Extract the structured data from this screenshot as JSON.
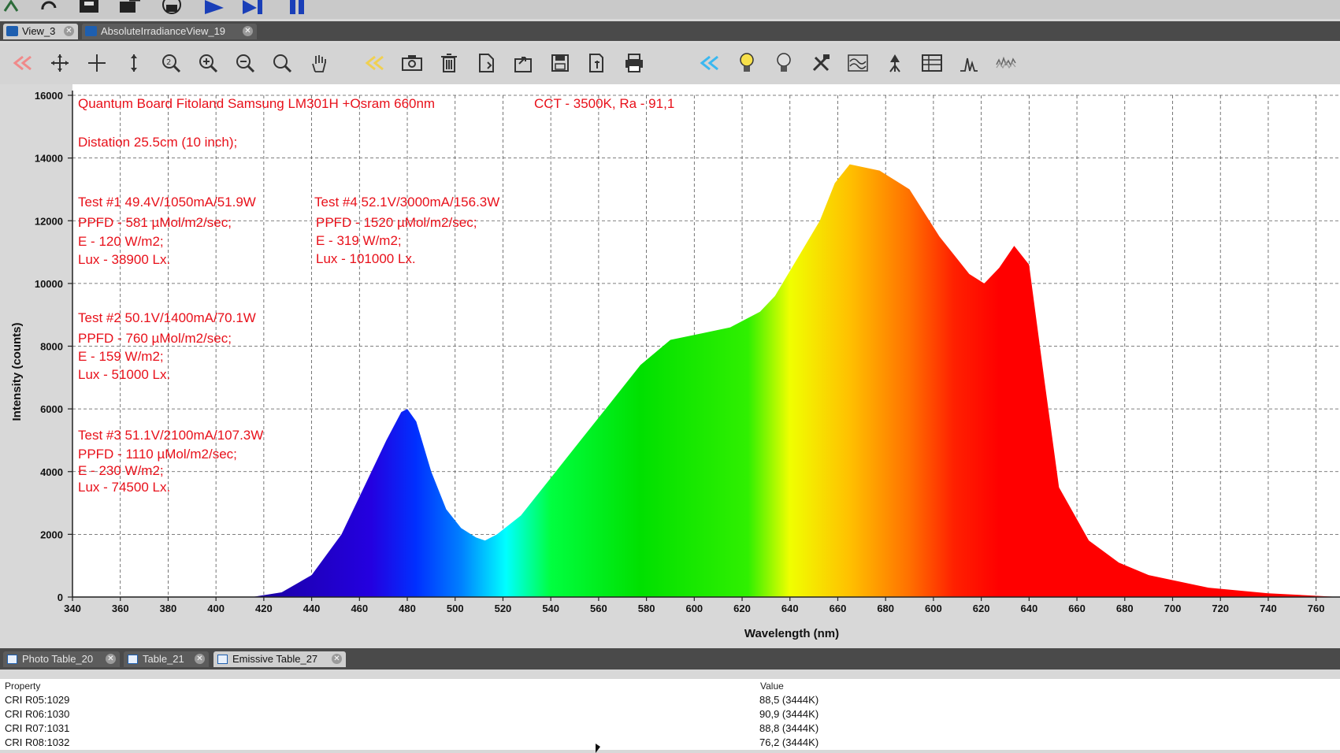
{
  "window_tabs": [
    {
      "label": "View_3",
      "active": true
    },
    {
      "label": "AbsoluteIrradianceView_19",
      "active": false
    }
  ],
  "toolbar_icons": [
    "back-red-icon",
    "move-cross-icon",
    "crosshair-icon",
    "vertical-arrow-icon",
    "zoom-reset-icon",
    "zoom-in-icon",
    "zoom-out-icon",
    "zoom-fit-icon",
    "pan-hand-icon",
    "back-yellow-icon",
    "camera-icon",
    "trash-icon",
    "copy-doc-icon",
    "export-icon",
    "save-icon",
    "doc-settings-icon",
    "print-icon",
    "back-cyan-icon",
    "bulb-on-icon",
    "bulb-off-icon",
    "tools-icon",
    "wave-icon",
    "peak-marker-icon",
    "table-icon",
    "spectrum-peak-icon",
    "spectrum-noise-icon"
  ],
  "chart_data": {
    "type": "area",
    "xlabel": "Wavelength (nm)",
    "ylabel": "Intensity (counts)",
    "xlim": [
      340,
      764
    ],
    "ylim": [
      0,
      16000
    ],
    "x_ticks": [
      "340",
      "360",
      "380",
      "400",
      "420",
      "440",
      "460",
      "480",
      "500",
      "520",
      "540",
      "560",
      "580",
      "600",
      "620",
      "640",
      "660",
      "680",
      "600",
      "620",
      "640",
      "660",
      "680",
      "700",
      "720",
      "740",
      "760"
    ],
    "y_ticks": [
      "0",
      "2000",
      "4000",
      "6000",
      "8000",
      "10000",
      "12000",
      "14000",
      "16000"
    ],
    "grid": true,
    "x": [
      340,
      400,
      410,
      420,
      430,
      440,
      445,
      450,
      452,
      455,
      460,
      465,
      470,
      475,
      478,
      482,
      490,
      500,
      510,
      520,
      530,
      540,
      550,
      560,
      570,
      575,
      580,
      590,
      595,
      600,
      610,
      620,
      630,
      640,
      645,
      650,
      655,
      660,
      665,
      670,
      680,
      690,
      700,
      720,
      740,
      764
    ],
    "y": [
      0,
      0,
      150,
      700,
      2000,
      4000,
      5000,
      5900,
      6000,
      5600,
      4000,
      2800,
      2200,
      1900,
      1800,
      2000,
      2600,
      3800,
      5000,
      6200,
      7400,
      8200,
      8400,
      8600,
      9100,
      9600,
      10400,
      12000,
      13200,
      13800,
      13600,
      13000,
      11500,
      10300,
      10000,
      10500,
      11200,
      10600,
      7000,
      3500,
      1800,
      1100,
      700,
      300,
      120,
      0
    ],
    "annotations": [
      "Quantum Board  Fitoland Samsung LM301H +Osram 660nm",
      "CCT - 3500K, Ra - 91,1",
      "Distation 25.5cm (10 inch);",
      "Test #1   49.4V/1050mA/51.9W",
      "PPFD - 581 µMol/m2/sec;",
      "E - 120 W/m2;",
      "Lux - 38900 Lx.",
      "Test #4 52.1V/3000mA/156.3W",
      "PPFD - 1520 µMol/m2/sec;",
      "E - 319 W/m2;",
      "Lux - 101000 Lx.",
      "Test #2 50.1V/1400mA/70.1W",
      "PPFD - 760 µMol/m2/sec;",
      "E - 159 W/m2;",
      "Lux - 51000 Lx.",
      "Test #3   51.1V/2100mA/107.3W",
      "PPFD - 1110 µMol/m2/sec;",
      "E - 230 W/m2;",
      "Lux - 74500 Lx."
    ],
    "annotation_color": "#e8101a"
  },
  "bottom_tabs": [
    {
      "label": "Photo Table_20",
      "active": false
    },
    {
      "label": "Table_21",
      "active": false
    },
    {
      "label": "Emissive Table_27",
      "active": true
    }
  ],
  "table": {
    "headers": [
      "Property",
      "Value"
    ],
    "rows": [
      [
        "CRI R05:1029",
        "88,5 (3444K)"
      ],
      [
        "CRI R06:1030",
        "90,9 (3444K)"
      ],
      [
        "CRI R07:1031",
        "88,8 (3444K)"
      ],
      [
        "CRI R08:1032",
        "76,2 (3444K)"
      ]
    ]
  }
}
